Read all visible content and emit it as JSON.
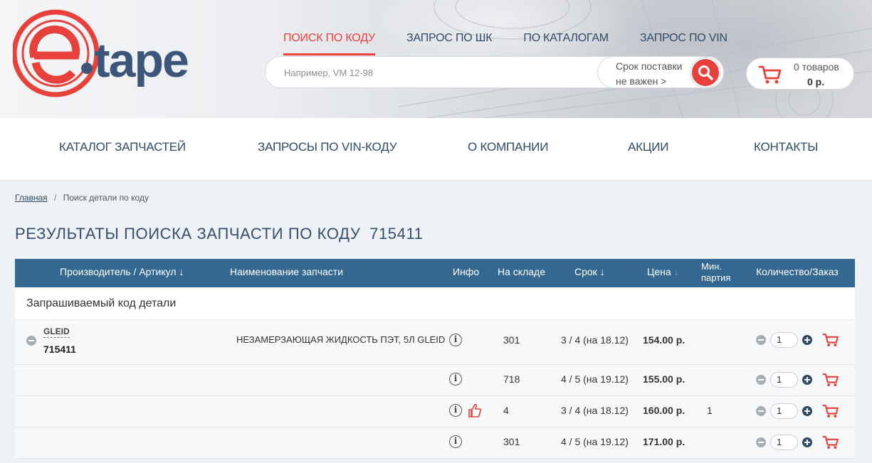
{
  "logo": {
    "text": "e-tape",
    "colors": {
      "red": "#e8413b",
      "navy": "#3b567a"
    }
  },
  "topnav": {
    "items": [
      {
        "label": "ПОИСК ПО КОДУ",
        "active": true
      },
      {
        "label": "ЗАПРОС ПО ШК",
        "active": false
      },
      {
        "label": "ПО КАТАЛОГАМ",
        "active": false
      },
      {
        "label": "ЗАПРОС ПО VIN",
        "active": false
      }
    ]
  },
  "search": {
    "placeholder": "Например, VM 12-98",
    "value": "",
    "delivery_line1": "Срок поставки",
    "delivery_line2": "не важен >",
    "button_icon": "search-icon"
  },
  "cart": {
    "count": "0 товаров",
    "sum": "0 р.",
    "icon": "cart-icon"
  },
  "mainnav": {
    "items": [
      {
        "label": "КАТАЛОГ ЗАПЧАСТЕЙ"
      },
      {
        "label": "ЗАПРОСЫ ПО VIN-КОДУ"
      },
      {
        "label": "О КОМПАНИИ"
      },
      {
        "label": "АКЦИИ"
      },
      {
        "label": "КОНТАКТЫ"
      }
    ]
  },
  "breadcrumb": {
    "home": "Главная",
    "separator": "/",
    "current": "Поиск детали по коду"
  },
  "page": {
    "title": "РЕЗУЛЬТАТЫ ПОИСКА ЗАПЧАСТИ ПО КОДУ",
    "code": "715411"
  },
  "table": {
    "headers": {
      "maker": "Производитель / Артикул ↓",
      "name": "Наименование запчасти",
      "info": "Инфо",
      "stock": "На складе",
      "term": "Срок ↓",
      "price": "Цена",
      "price_arrow": "↓",
      "min_line1": "Мин.",
      "min_line2": "партия",
      "qty": "Количество/Заказ"
    },
    "group_label": "Запрашиваемый код детали",
    "product": {
      "brand": "GLEID",
      "article": "715411",
      "name": "НЕЗАМЕРЗАЮЩАЯ ЖИДКОСТЬ ПЭТ, 5Л GLEID"
    },
    "rows": [
      {
        "stock": "301",
        "term": "3 / 4 (на 18.12)",
        "price": "154.00 р.",
        "min": "",
        "qty": "1",
        "recommended": false
      },
      {
        "stock": "718",
        "term": "4 / 5 (на 19.12)",
        "price": "155.00 р.",
        "min": "",
        "qty": "1",
        "recommended": false
      },
      {
        "stock": "4",
        "term": "3 / 4 (на 18.12)",
        "price": "160.00 р.",
        "min": "1",
        "qty": "1",
        "recommended": true
      },
      {
        "stock": "301",
        "term": "4 / 5 (на 19.12)",
        "price": "171.00 р.",
        "min": "",
        "qty": "1",
        "recommended": false
      }
    ],
    "info_glyph": "i"
  },
  "colors": {
    "accent": "#e8413b",
    "navy": "#2f4a66",
    "table_header": "#346890",
    "price_arrow": "#3fa9f5"
  }
}
